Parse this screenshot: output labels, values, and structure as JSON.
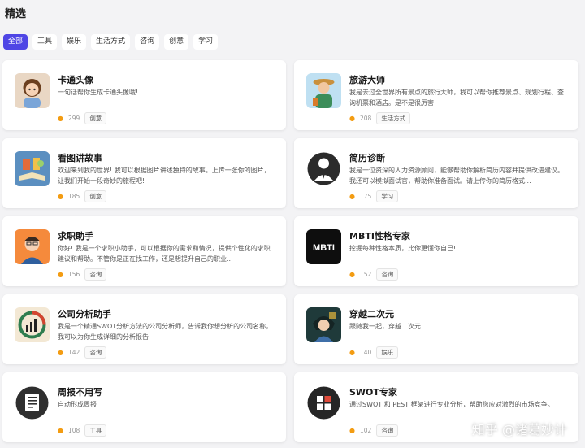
{
  "page": {
    "title": "精选"
  },
  "tabs": [
    {
      "label": "全部",
      "active": true
    },
    {
      "label": "工具",
      "active": false
    },
    {
      "label": "娱乐",
      "active": false
    },
    {
      "label": "生活方式",
      "active": false
    },
    {
      "label": "咨询",
      "active": false
    },
    {
      "label": "创意",
      "active": false
    },
    {
      "label": "学习",
      "active": false
    }
  ],
  "cards": [
    {
      "title": "卡通头像",
      "desc": "一句话帮你生成卡通头像哦!",
      "count": "299",
      "tag": "创意",
      "icon": "cartoon-girl-icon"
    },
    {
      "title": "旅游大师",
      "desc": "我是去过全世界所有景点的旅行大师，我可以帮你推荐景点、规划行程、查询机票和酒店。是不是很厉害!",
      "count": "208",
      "tag": "生活方式",
      "icon": "traveler-icon"
    },
    {
      "title": "看图讲故事",
      "desc": "欢迎来到我的世界! 我可以根据图片讲述独特的故事。上传一张你的图片，让我们开始一段奇妙的旅程吧!",
      "count": "185",
      "tag": "创意",
      "icon": "storybook-icon"
    },
    {
      "title": "简历诊断",
      "desc": "我是一位资深的人力资源顾问，能够帮助你解析简历内容并提供改进建议。我还可以模拟面试官，帮助你准备面试。请上传你的简历格式...",
      "count": "175",
      "tag": "学习",
      "icon": "businessman-icon"
    },
    {
      "title": "求职助手",
      "desc": "你好! 我是一个求职小助手，可以根据你的需求和情况，提供个性化的求职建议和帮助。不管你是正在找工作，还是想提升自己的职业...",
      "count": "156",
      "tag": "咨询",
      "icon": "job-seeker-icon"
    },
    {
      "title": "MBTI性格专家",
      "desc": "挖掘每种性格本质，比你更懂你自己!",
      "count": "152",
      "tag": "咨询",
      "icon": "mbti-icon"
    },
    {
      "title": "公司分析助手",
      "desc": "我是一个精通SWOT分析方法的公司分析师，告诉我你想分析的公司名称，我可以为你生成详细的分析报告",
      "count": "142",
      "tag": "咨询",
      "icon": "chart-analysis-icon"
    },
    {
      "title": "穿越二次元",
      "desc": "跟随我一起，穿越二次元!",
      "count": "140",
      "tag": "娱乐",
      "icon": "anime-character-icon"
    },
    {
      "title": "周报不用写",
      "desc": "自动形成周报",
      "count": "108",
      "tag": "工具",
      "icon": "report-document-icon"
    },
    {
      "title": "SWOT专家",
      "desc": "通过SWOT 和 PEST 框架进行专业分析，帮助您应对激烈的市场竞争。",
      "count": "102",
      "tag": "咨询",
      "icon": "swot-icon"
    }
  ],
  "watermark": "知乎 @诸葛妙计",
  "colors": {
    "accent": "#4f46e5",
    "fire": "#f39c12"
  }
}
